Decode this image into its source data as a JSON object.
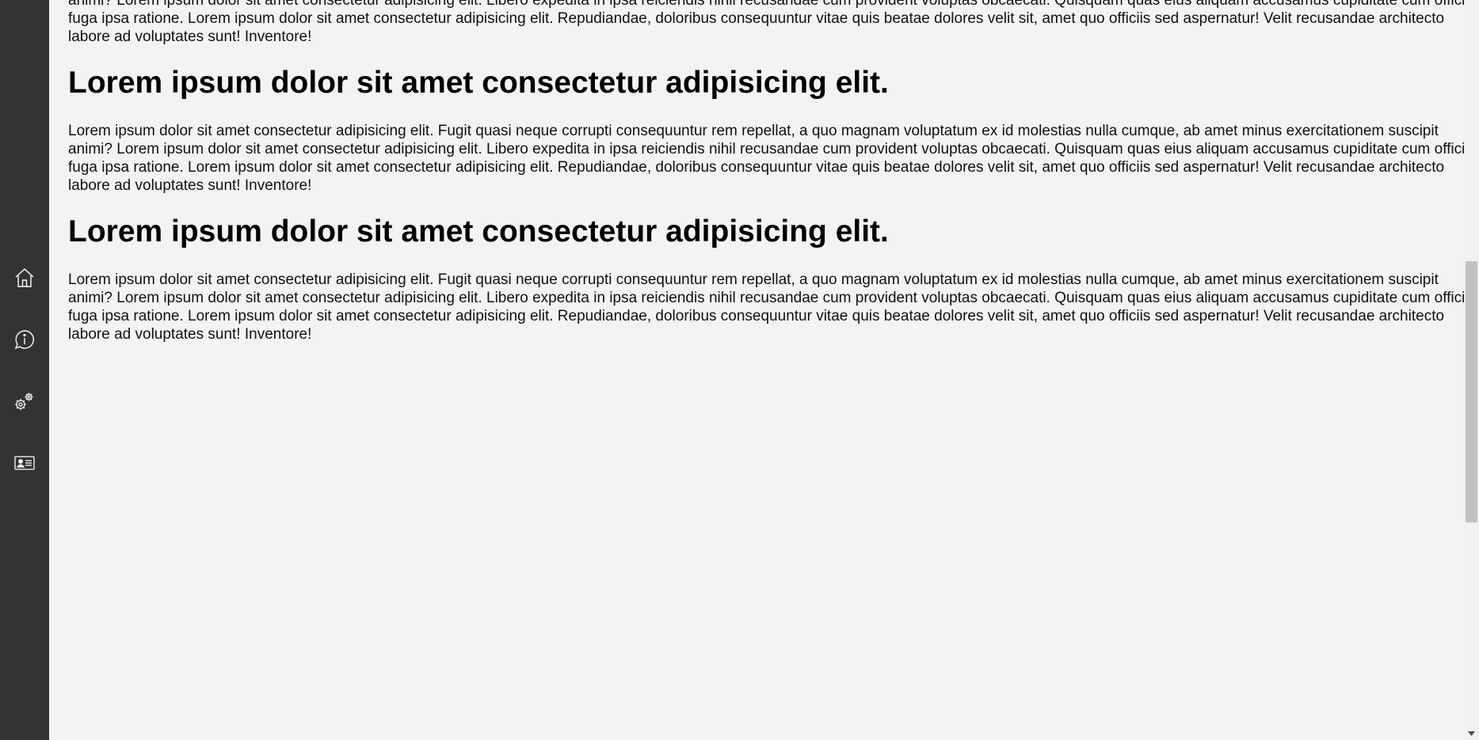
{
  "sidebar": {
    "items": [
      {
        "name": "home",
        "icon": "home-icon"
      },
      {
        "name": "info",
        "icon": "info-chat-icon"
      },
      {
        "name": "settings",
        "icon": "gears-icon"
      },
      {
        "name": "contact",
        "icon": "contact-card-icon"
      }
    ],
    "background": "#333333"
  },
  "content": {
    "top_partial_paragraph": "Lorem ipsum dolor sit amet consectetur adipisicing elit. Fugit quasi neque corrupti consequuntur rem repellat, a quo magnam voluptatum ex id molestias nulla cumque, ab amet minus exercitationem suscipit animi? Lorem ipsum dolor sit amet consectetur adipisicing elit. Libero expedita in ipsa reiciendis nihil recusandae cum provident voluptas obcaecati. Quisquam quas eius aliquam accusamus cupiditate cum officia fuga ipsa ratione. Lorem ipsum dolor sit amet consectetur adipisicing elit. Repudiandae, doloribus consequuntur vitae quis beatae dolores velit sit, amet quo officiis sed aspernatur! Velit recusandae architecto labore ad voluptates sunt! Inventore!",
    "sections": [
      {
        "heading": "Lorem ipsum dolor sit amet consectetur adipisicing elit.",
        "paragraph": "Lorem ipsum dolor sit amet consectetur adipisicing elit. Fugit quasi neque corrupti consequuntur rem repellat, a quo magnam voluptatum ex id molestias nulla cumque, ab amet minus exercitationem suscipit animi? Lorem ipsum dolor sit amet consectetur adipisicing elit. Libero expedita in ipsa reiciendis nihil recusandae cum provident voluptas obcaecati. Quisquam quas eius aliquam accusamus cupiditate cum officia fuga ipsa ratione. Lorem ipsum dolor sit amet consectetur adipisicing elit. Repudiandae, doloribus consequuntur vitae quis beatae dolores velit sit, amet quo officiis sed aspernatur! Velit recusandae architecto labore ad voluptates sunt! Inventore!"
      },
      {
        "heading": "Lorem ipsum dolor sit amet consectetur adipisicing elit.",
        "paragraph": "Lorem ipsum dolor sit amet consectetur adipisicing elit. Fugit quasi neque corrupti consequuntur rem repellat, a quo magnam voluptatum ex id molestias nulla cumque, ab amet minus exercitationem suscipit animi? Lorem ipsum dolor sit amet consectetur adipisicing elit. Libero expedita in ipsa reiciendis nihil recusandae cum provident voluptas obcaecati. Quisquam quas eius aliquam accusamus cupiditate cum officia fuga ipsa ratione. Lorem ipsum dolor sit amet consectetur adipisicing elit. Repudiandae, doloribus consequuntur vitae quis beatae dolores velit sit, amet quo officiis sed aspernatur! Velit recusandae architecto labore ad voluptates sunt! Inventore!"
      }
    ]
  },
  "colors": {
    "page_background": "#f3f3f3",
    "sidebar_background": "#333333",
    "icon_stroke": "#ffffff",
    "scroll_thumb": "#c1c1c1"
  }
}
